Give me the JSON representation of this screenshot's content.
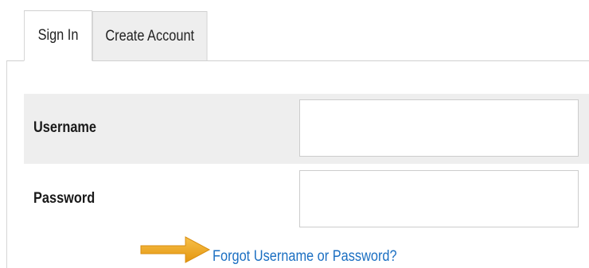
{
  "tabs": [
    {
      "label": "Sign In",
      "active": true
    },
    {
      "label": "Create Account",
      "active": false
    }
  ],
  "form": {
    "username": {
      "label": "Username",
      "value": "",
      "placeholder": ""
    },
    "password": {
      "label": "Password",
      "value": "",
      "placeholder": ""
    }
  },
  "forgot_link": {
    "label": "Forgot Username or Password?"
  },
  "annotation": {
    "icon": "arrow-right-icon",
    "color": "#f2a81d"
  },
  "colors": {
    "link": "#1b6fc2",
    "row_alt": "#eeeeee",
    "inactive_tab": "#eeeeee",
    "border": "#d0d0d0"
  }
}
